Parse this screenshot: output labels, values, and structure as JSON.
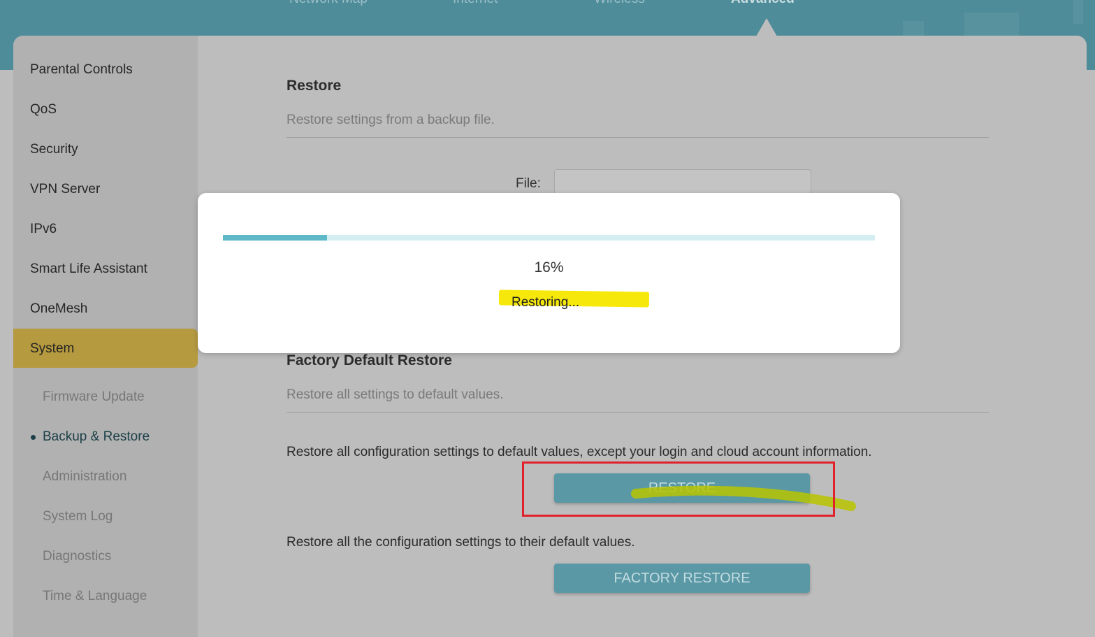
{
  "top_nav": {
    "items": [
      {
        "label": "Network Map"
      },
      {
        "label": "Internet"
      },
      {
        "label": "Wireless"
      },
      {
        "label": "Advanced"
      }
    ],
    "active": "Advanced"
  },
  "sidebar": {
    "items": [
      {
        "label": "Parental Controls"
      },
      {
        "label": "QoS"
      },
      {
        "label": "Security"
      },
      {
        "label": "VPN Server"
      },
      {
        "label": "IPv6"
      },
      {
        "label": "Smart Life Assistant"
      },
      {
        "label": "OneMesh"
      },
      {
        "label": "System"
      }
    ],
    "active": "System",
    "subitems": [
      {
        "label": "Firmware Update"
      },
      {
        "label": "Backup & Restore"
      },
      {
        "label": "Administration"
      },
      {
        "label": "System Log"
      },
      {
        "label": "Diagnostics"
      },
      {
        "label": "Time & Language"
      }
    ],
    "active_sub": "Backup & Restore"
  },
  "restore": {
    "title": "Restore",
    "subtitle": "Restore settings from a backup file.",
    "file_label": "File:"
  },
  "factory": {
    "title": "Factory Default Restore",
    "subtitle": "Restore all settings to default values.",
    "restore_desc": "Restore all configuration settings to default values, except your login and cloud account information.",
    "restore_button": "RESTORE",
    "factory_desc": "Restore all the configuration settings to their default values.",
    "factory_button": "FACTORY RESTORE"
  },
  "modal": {
    "progress_percent": 16,
    "percent_text": "16%",
    "status_text": "Restoring..."
  },
  "colors": {
    "header": "#4f8c99",
    "accent": "#5db9c8",
    "active_sidebar": "#b59a40",
    "highlight": "#f7e80b",
    "annotation_red": "#e0212c"
  }
}
